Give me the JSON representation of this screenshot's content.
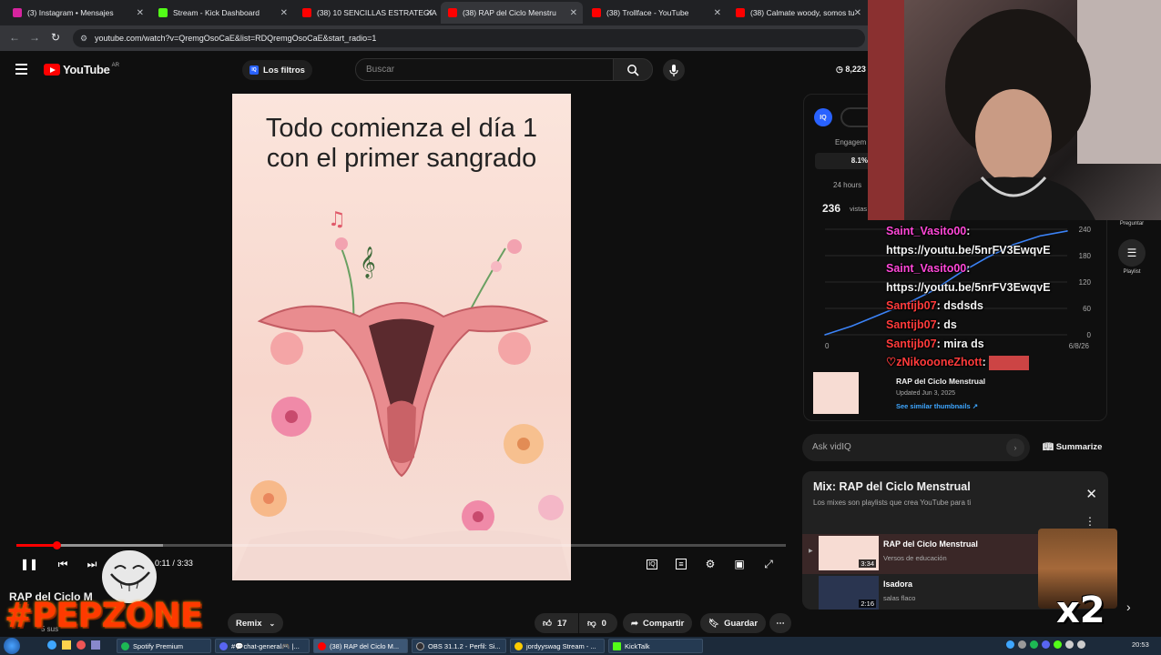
{
  "browser": {
    "tabs": [
      {
        "label": "(3) Instagram • Mensajes",
        "color": "#d6249f"
      },
      {
        "label": "Stream - Kick Dashboard",
        "color": "#53fc18"
      },
      {
        "label": "(38) 10 SENCILLAS ESTRATEGIA",
        "color": "#ff0000"
      },
      {
        "label": "(38) RAP del Ciclo Menstru",
        "color": "#ff0000"
      },
      {
        "label": "(38) Trollface - YouTube",
        "color": "#ff0000"
      },
      {
        "label": "(38) Calmate woody, somos tu",
        "color": "#ff0000"
      }
    ],
    "url": "youtube.com/watch?v=QremgOsoCaE&list=RDQremgOsoCaE&start_radio=1"
  },
  "header": {
    "logo_text": "YouTube",
    "country": "AR",
    "filters_label": "Los filtros",
    "iq_badge": "IQ",
    "search_placeholder": "Buscar",
    "views_count": "8,223"
  },
  "video": {
    "overlay_text": "Todo comienza el día 1 con el primer sangrado",
    "time_display": "0:11 / 3:33",
    "progress_fraction": 0.052,
    "buffered_fraction": 0.19,
    "title_partial": "RAP del Ciclo M",
    "subs_partial": "5 sus"
  },
  "actions": {
    "remix_label": "Remix",
    "likes": "17",
    "dislikes": "0",
    "share_label": "Compartir",
    "save_label": "Guardar"
  },
  "vidiq": {
    "engagement_label": "Engagem",
    "engagement_value": "8.1%",
    "window_label": "24 hours",
    "views_value": "236",
    "views_label": "vistas",
    "y_ticks": [
      "240",
      "180",
      "120",
      "60",
      "0"
    ],
    "x_left": "0",
    "x_right": "6/8/26",
    "video_title": "RAP del Ciclo Menstrual",
    "updated": "Updated Jun 3, 2025",
    "similar_link": "See similar thumbnails ↗",
    "ask_placeholder": "Ask vidIQ",
    "summarize_label": "Summarize"
  },
  "chart_data": {
    "type": "line",
    "title": "",
    "xlabel": "",
    "ylabel": "",
    "x_tick_labels": [
      "0",
      "6/8/26"
    ],
    "ylim": [
      0,
      240
    ],
    "y_ticks": [
      0,
      60,
      120,
      180,
      240
    ],
    "series": [
      {
        "values": [
          0,
          20,
          45,
          70,
          100,
          140,
          175,
          205,
          225,
          236
        ]
      }
    ],
    "grid": true,
    "color": "#3b82f6"
  },
  "mix": {
    "title": "Mix: RAP del Ciclo Menstrual",
    "subtitle": "Los mixes son playlists que crea YouTube para ti",
    "items": [
      {
        "title": "RAP del Ciclo Menstrual",
        "channel": "Versos de educación",
        "duration": "3:34"
      },
      {
        "title": "Isadora",
        "channel": "salas flaco",
        "duration": "2:16"
      }
    ]
  },
  "chat": {
    "messages": [
      {
        "user": "Saint_Vasito00",
        "text": "",
        "type": "pink"
      },
      {
        "user": "",
        "text": "https://youtu.be/5nrFV3EwqvE",
        "type": "text"
      },
      {
        "user": "Saint_Vasito00",
        "text": "",
        "type": "pink"
      },
      {
        "user": "",
        "text": "https://youtu.be/5nrFV3EwqvE",
        "type": "text"
      },
      {
        "user": "Santijb07",
        "text": "dsdsds",
        "type": "red"
      },
      {
        "user": "Santijb07",
        "text": "ds",
        "type": "red"
      },
      {
        "user": "Santijb07",
        "text": "mira ds",
        "type": "red"
      },
      {
        "user": "♡zNikoooneZhott",
        "text": "",
        "type": "pink"
      }
    ]
  },
  "side_labels": {
    "ask": "Preguntar",
    "playlist": "Playlist"
  },
  "overlay": {
    "watermark": "#PEPZONE",
    "multiplier": "x2"
  },
  "taskbar": {
    "items": [
      {
        "label": "Spotify Premium",
        "color": "#1db954"
      },
      {
        "label": "#💬chat-general🎮 |...",
        "color": "#5865f2"
      },
      {
        "label": "(38) RAP del Ciclo M...",
        "color": "#ff0000"
      },
      {
        "label": "OBS 31.1.2 - Perfil: Si...",
        "color": "#302e31"
      },
      {
        "label": "jordyyswag Stream - ...",
        "color": "#ffcc00"
      },
      {
        "label": "KickTalk",
        "color": "#53fc18"
      }
    ],
    "clock": "20:53"
  }
}
